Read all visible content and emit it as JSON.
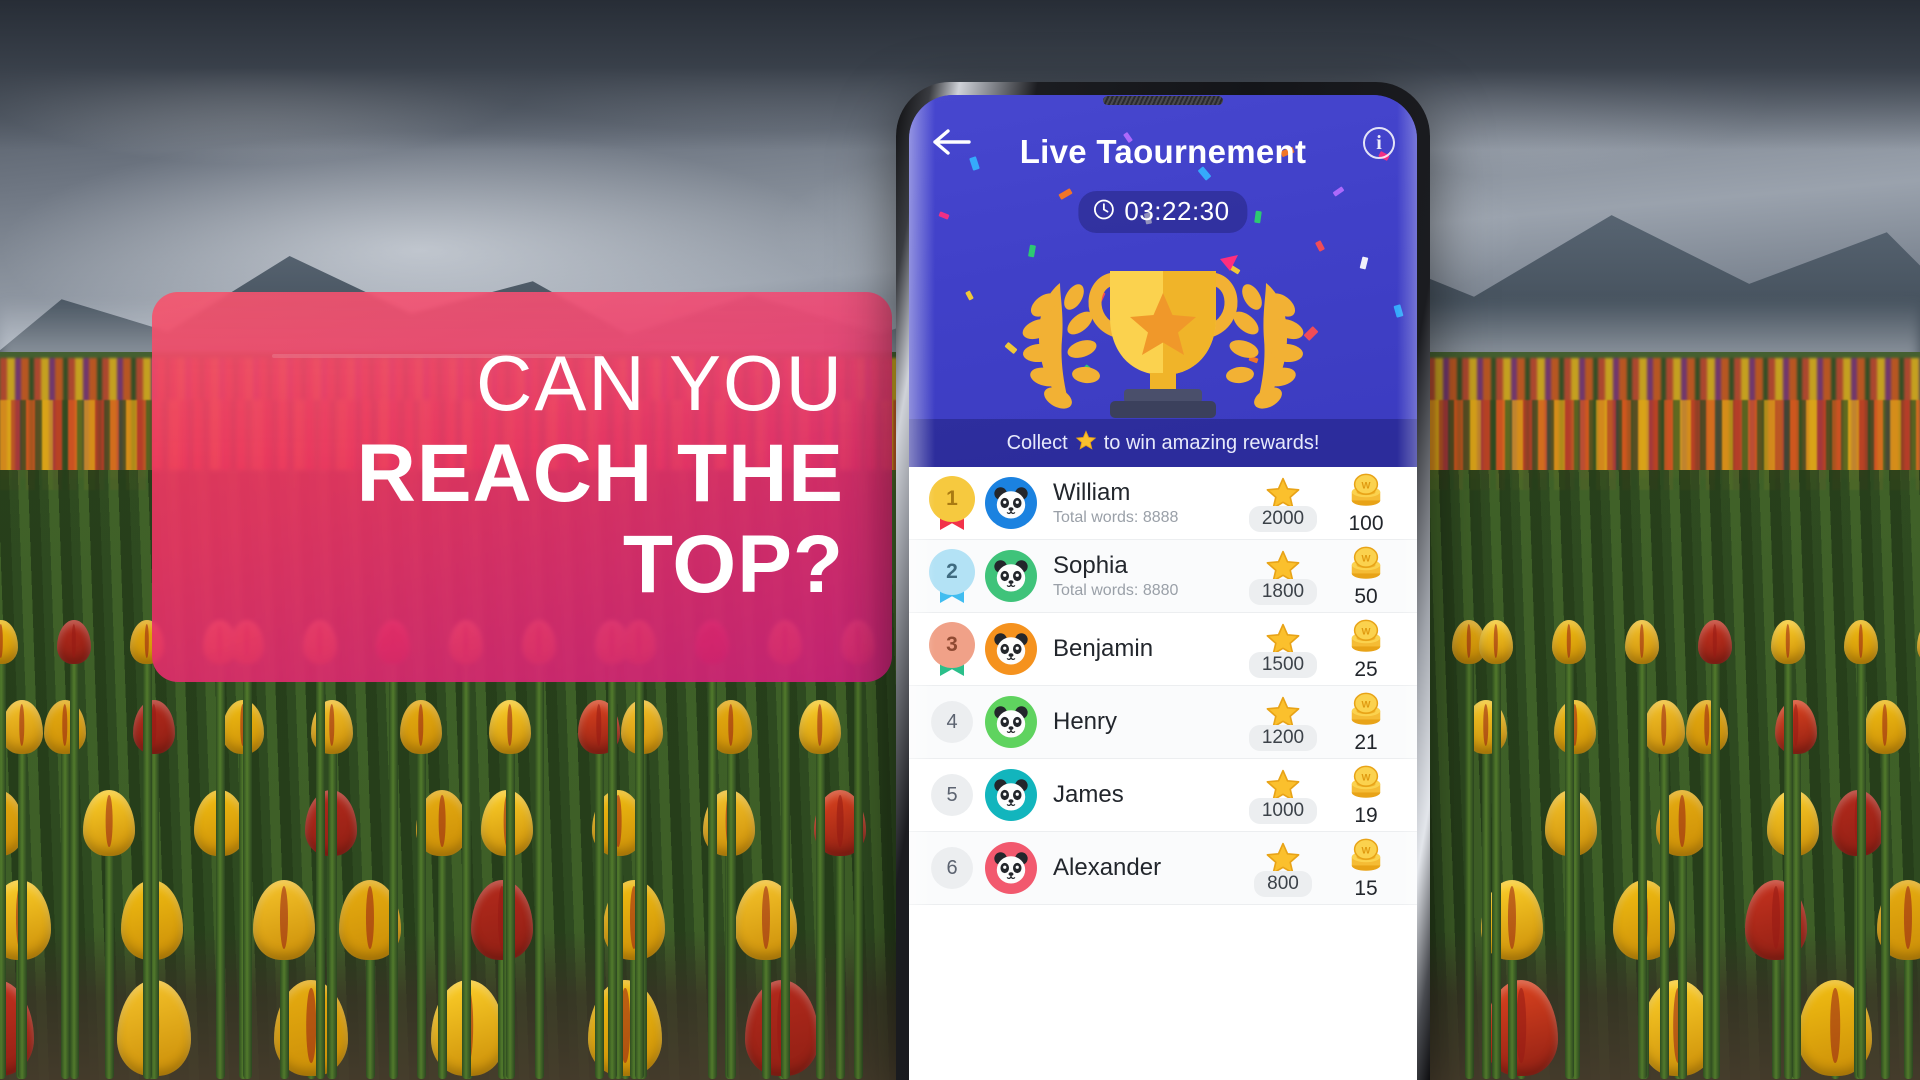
{
  "promo": {
    "line1": "CAN YOU",
    "line2": "REACH THE",
    "line3": "TOP?",
    "card_color": "#ed3465"
  },
  "phone": {
    "header": {
      "back_icon": "arrow-left-icon",
      "title": "Live Taournement",
      "info_icon": "info-icon",
      "clock_icon": "clock-icon",
      "timer": "03:22:30",
      "trophy_icon": "trophy-icon",
      "banner_prefix": "Collect",
      "banner_star": "star-icon",
      "banner_suffix": "to win amazing rewards!",
      "accent_color": "#4040c8"
    },
    "leaderboard": {
      "rows": [
        {
          "rank": "1",
          "name": "William",
          "sub": "Total words: 8888",
          "stars": "2000",
          "coins": "100",
          "avatar_color": "#1b82e0",
          "medal_disc": "#f6c93f",
          "medal_text": "#a97a12",
          "ribbon_color": "#f2324a"
        },
        {
          "rank": "2",
          "name": "Sophia",
          "sub": "Total words: 8880",
          "stars": "1800",
          "coins": "50",
          "avatar_color": "#3fc37a",
          "medal_disc": "#b3e2f5",
          "medal_text": "#3f6b80",
          "ribbon_color": "#41bdf0"
        },
        {
          "rank": "3",
          "name": "Benjamin",
          "sub": "",
          "stars": "1500",
          "coins": "25",
          "avatar_color": "#f5921e",
          "medal_disc": "#f0a188",
          "medal_text": "#8f4a33",
          "ribbon_color": "#2bbf8a"
        },
        {
          "rank": "4",
          "name": "Henry",
          "sub": "",
          "stars": "1200",
          "coins": "21",
          "avatar_color": "#5fd35f",
          "medal_disc": "",
          "medal_text": "",
          "ribbon_color": ""
        },
        {
          "rank": "5",
          "name": "James",
          "sub": "",
          "stars": "1000",
          "coins": "19",
          "avatar_color": "#12b5bd",
          "medal_disc": "",
          "medal_text": "",
          "ribbon_color": ""
        },
        {
          "rank": "6",
          "name": "Alexander",
          "sub": "",
          "stars": "800",
          "coins": "15",
          "avatar_color": "#f2596e",
          "medal_disc": "",
          "medal_text": "",
          "ribbon_color": ""
        }
      ]
    }
  }
}
